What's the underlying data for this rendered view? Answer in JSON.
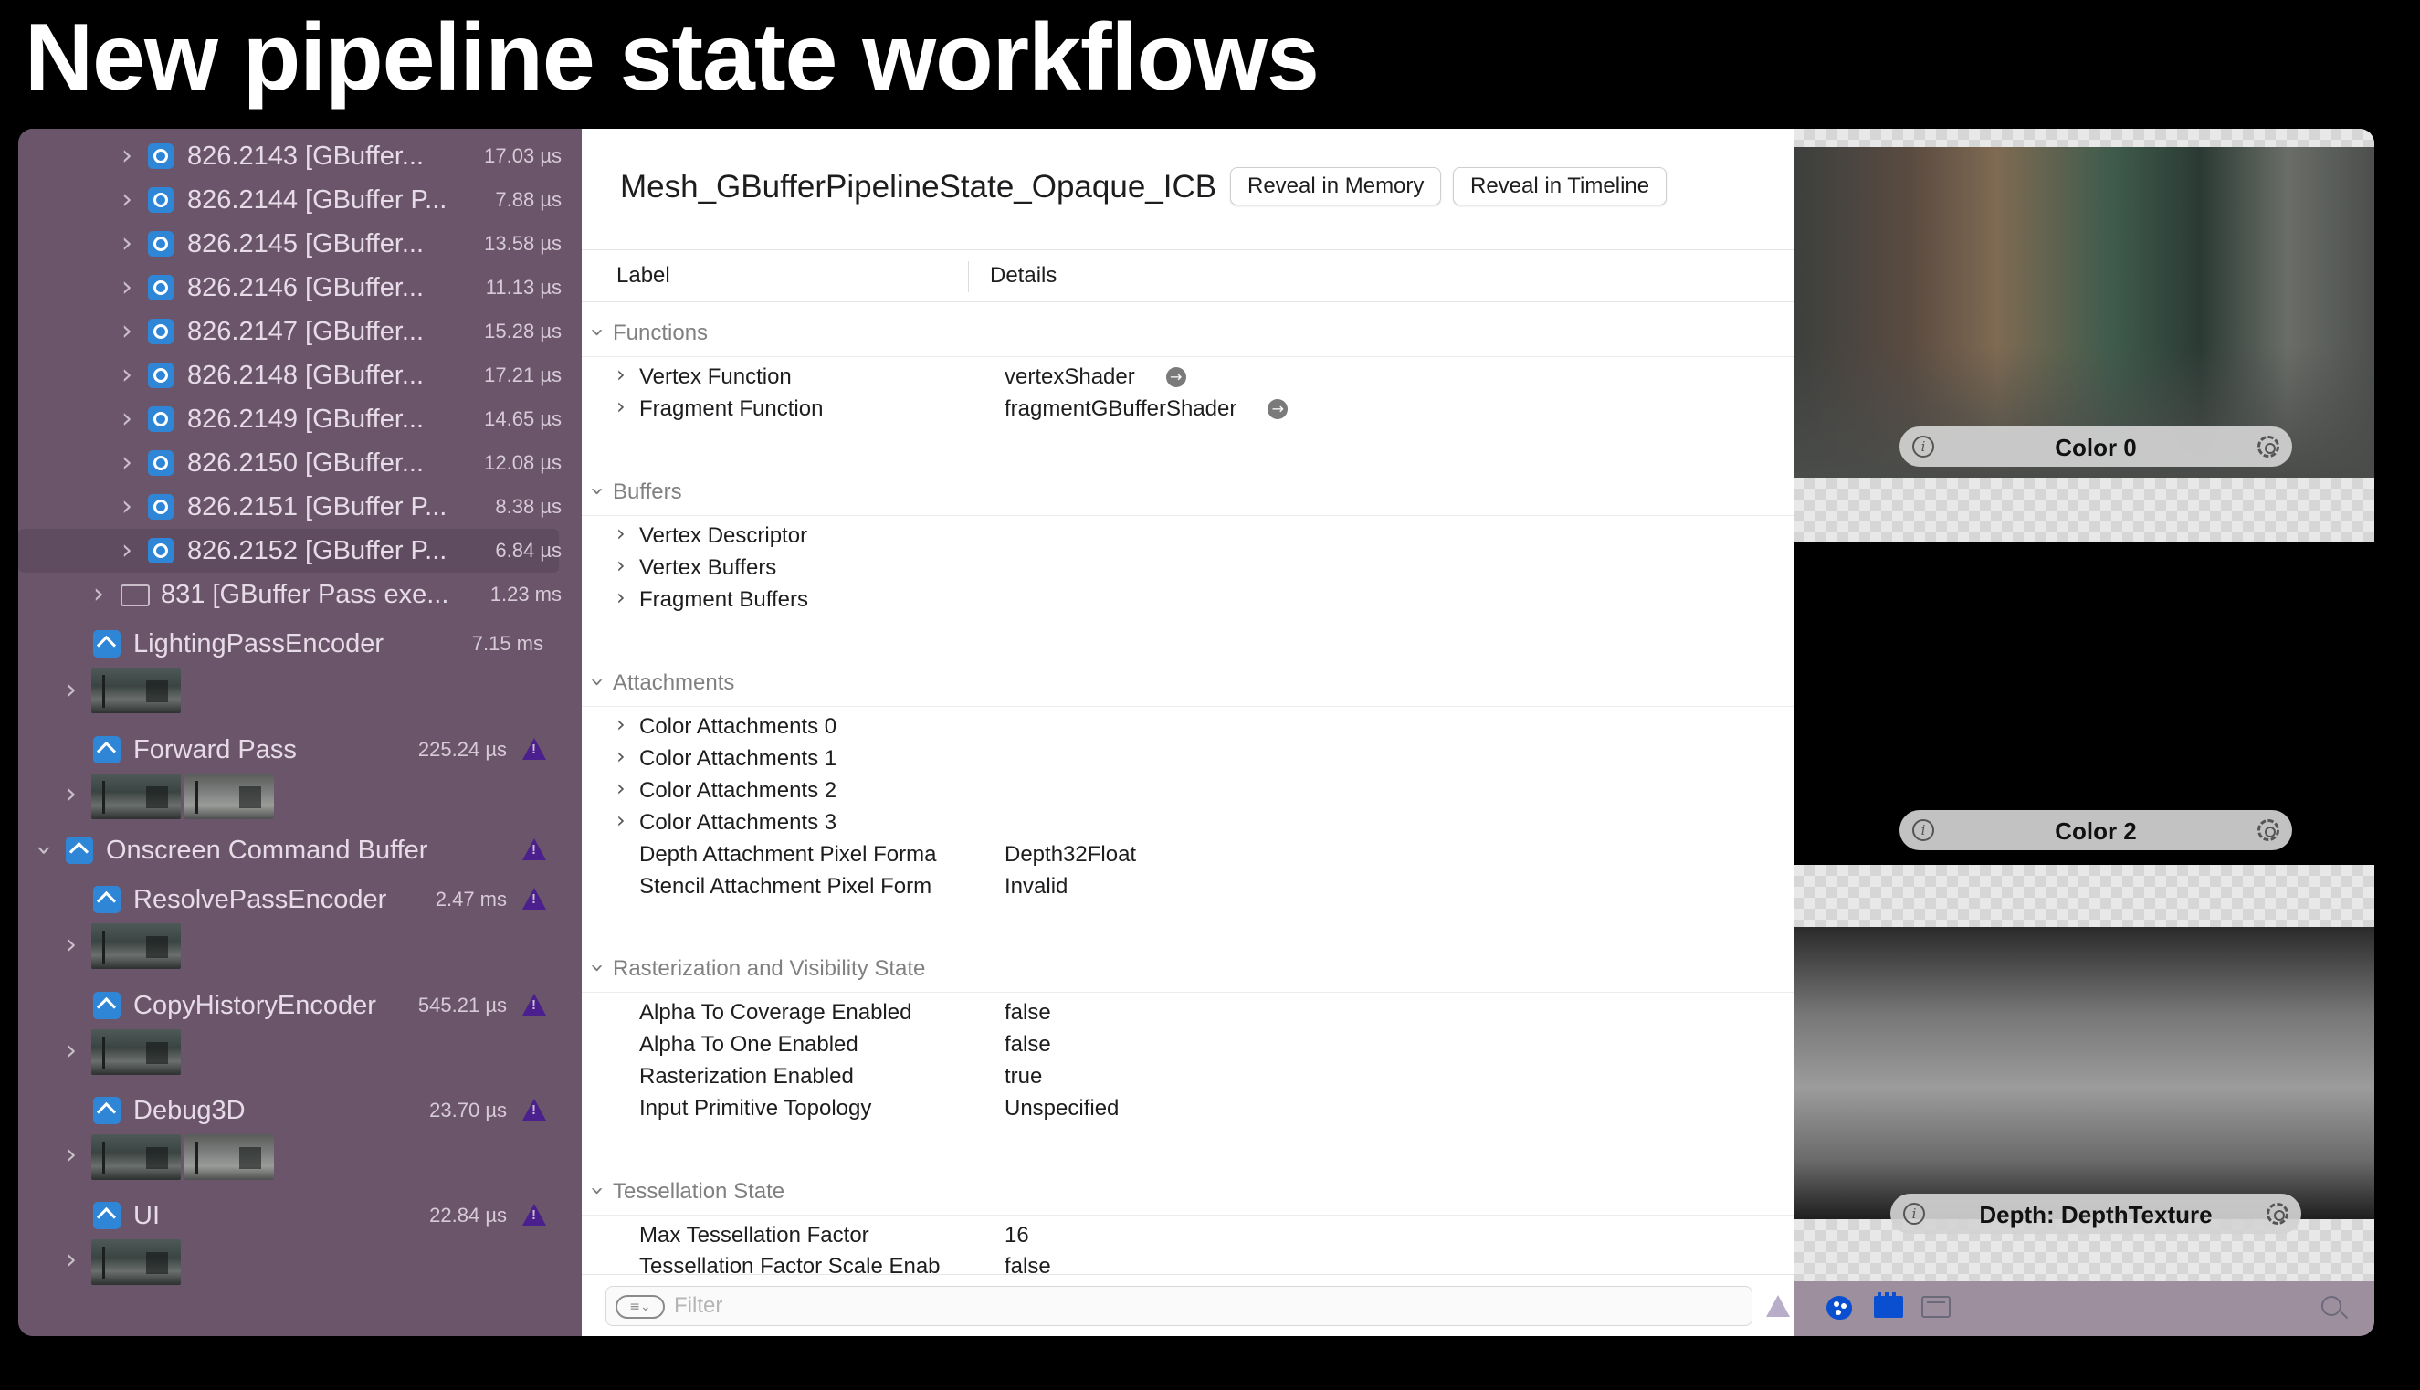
{
  "slide": {
    "title": "New pipeline state workflows"
  },
  "navigator": {
    "draw_calls": [
      {
        "label": "826.2143 [GBuffer...",
        "time": "17.03 µs"
      },
      {
        "label": "826.2144 [GBuffer P...",
        "time": "7.88 µs"
      },
      {
        "label": "826.2145 [GBuffer...",
        "time": "13.58 µs"
      },
      {
        "label": "826.2146 [GBuffer...",
        "time": "11.13 µs"
      },
      {
        "label": "826.2147 [GBuffer...",
        "time": "15.28 µs"
      },
      {
        "label": "826.2148 [GBuffer...",
        "time": "17.21 µs"
      },
      {
        "label": "826.2149 [GBuffer...",
        "time": "14.65 µs"
      },
      {
        "label": "826.2150 [GBuffer...",
        "time": "12.08 µs"
      },
      {
        "label": "826.2151 [GBuffer P...",
        "time": "8.38 µs"
      },
      {
        "label": "826.2152 [GBuffer P...",
        "time": "6.84 µs"
      }
    ],
    "group": {
      "label": "831 [GBuffer Pass exe...",
      "time": "1.23 ms"
    },
    "lighting_encoder": {
      "label": "LightingPassEncoder",
      "time": "7.15 ms"
    },
    "forward_pass": {
      "label": "Forward Pass",
      "time": "225.24 µs"
    },
    "onscreen_buffer": {
      "label": "Onscreen Command Buffer"
    },
    "resolve_encoder": {
      "label": "ResolvePassEncoder",
      "time": "2.47 ms"
    },
    "copy_history_encoder": {
      "label": "CopyHistoryEncoder",
      "time": "545.21 µs"
    },
    "debug3d": {
      "label": "Debug3D",
      "time": "23.70 µs"
    },
    "ui": {
      "label": "UI",
      "time": "22.84 µs"
    }
  },
  "panel": {
    "title": "Mesh_GBufferPipelineState_Opaque_ICB",
    "reveal_memory": "Reveal in Memory",
    "reveal_timeline": "Reveal in Timeline",
    "col_label": "Label",
    "col_details": "Details",
    "sections": {
      "functions": "Functions",
      "buffers": "Buffers",
      "attachments": "Attachments",
      "raster": "Rasterization and Visibility State",
      "tess": "Tessellation State"
    },
    "functions": [
      {
        "label": "Vertex Function",
        "value": "vertexShader"
      },
      {
        "label": "Fragment Function",
        "value": "fragmentGBufferShader"
      }
    ],
    "buffers": [
      "Vertex Descriptor",
      "Vertex Buffers",
      "Fragment Buffers"
    ],
    "attachments_expandable": [
      "Color Attachments 0",
      "Color Attachments 1",
      "Color Attachments 2",
      "Color Attachments 3"
    ],
    "attachments_props": [
      {
        "label": "Depth Attachment Pixel Forma",
        "value": "Depth32Float"
      },
      {
        "label": "Stencil Attachment Pixel Form",
        "value": "Invalid"
      }
    ],
    "raster": [
      {
        "label": "Alpha To Coverage Enabled",
        "value": "false"
      },
      {
        "label": "Alpha To One Enabled",
        "value": "false"
      },
      {
        "label": "Rasterization Enabled",
        "value": "true"
      },
      {
        "label": "Input Primitive Topology",
        "value": "Unspecified"
      }
    ],
    "tess": [
      {
        "label": "Max Tessellation Factor",
        "value": "16"
      },
      {
        "label": "Tessellation Factor Scale Enab",
        "value": "false"
      }
    ],
    "filter_placeholder": "Filter"
  },
  "viewer": {
    "attachments": [
      "Color 0",
      "Color 2",
      "Depth: DepthTexture"
    ]
  }
}
